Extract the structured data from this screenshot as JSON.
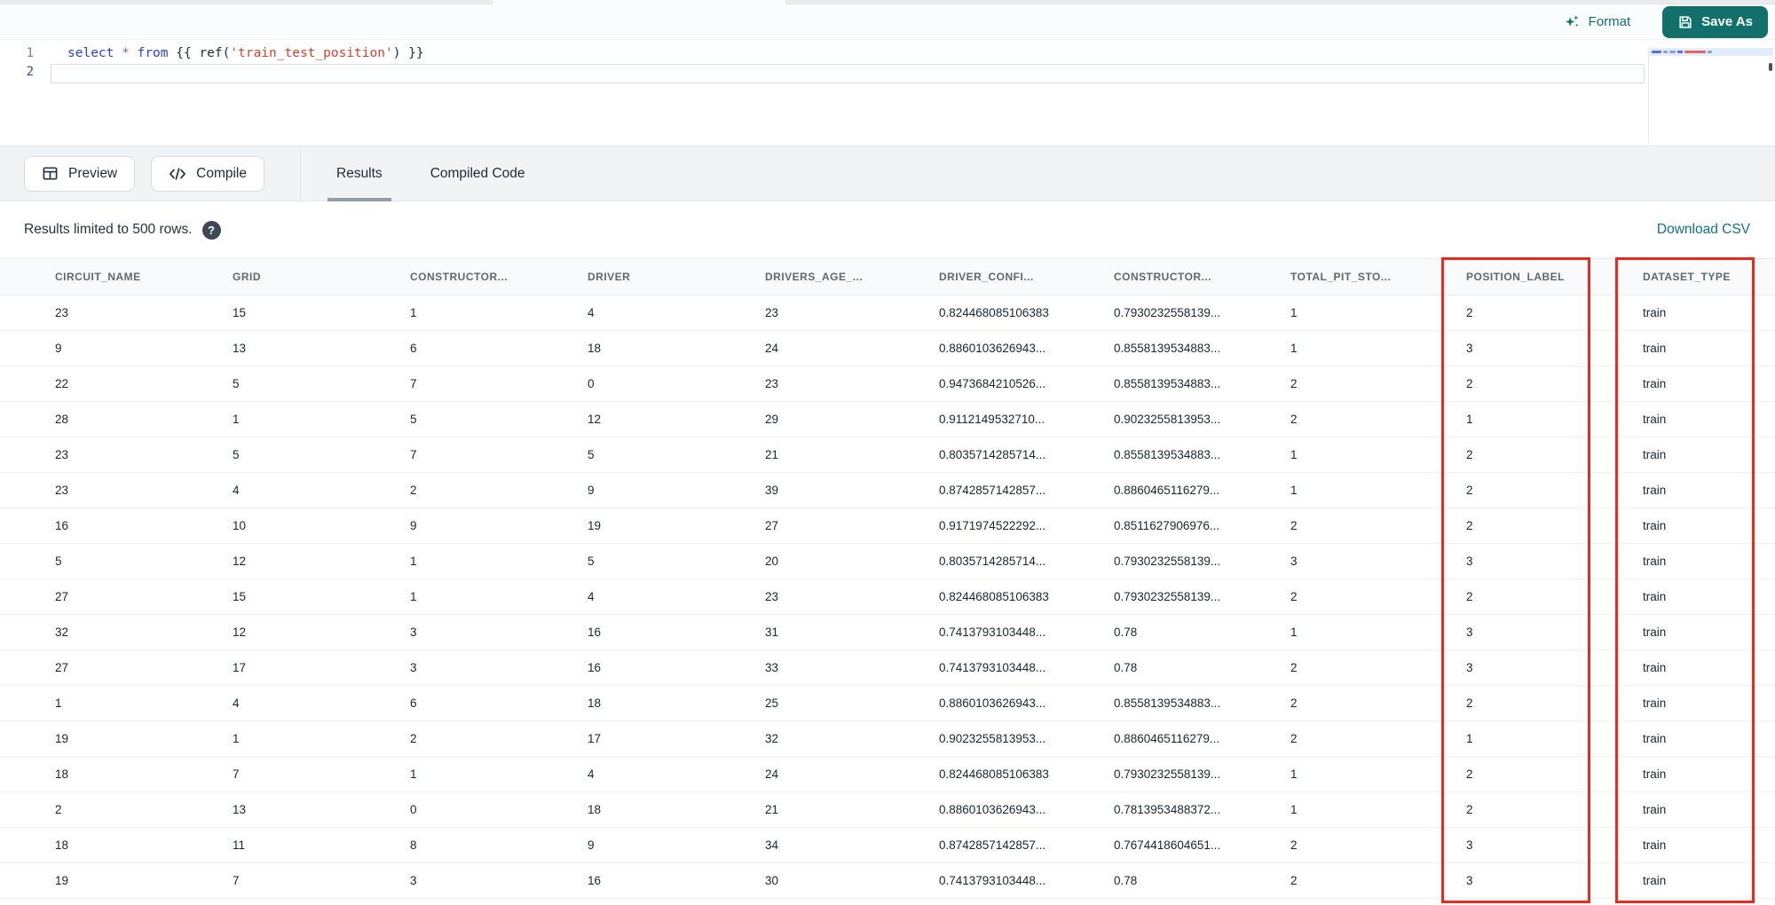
{
  "editor_header": {
    "format_label": "Format",
    "save_as_label": "Save As"
  },
  "code_editor": {
    "line_numbers": [
      "1",
      "2"
    ],
    "lines": [
      {
        "tokens": [
          {
            "text": "select",
            "type": "keyword"
          },
          {
            "text": " ",
            "type": "plain"
          },
          {
            "text": "*",
            "type": "operator"
          },
          {
            "text": " ",
            "type": "plain"
          },
          {
            "text": "from",
            "type": "keyword"
          },
          {
            "text": " {{ ",
            "type": "plain"
          },
          {
            "text": "ref",
            "type": "function"
          },
          {
            "text": "(",
            "type": "plain"
          },
          {
            "text": "'train_test_position'",
            "type": "string"
          },
          {
            "text": ")",
            "type": "plain"
          },
          {
            "text": " }}",
            "type": "plain"
          }
        ]
      },
      {
        "tokens": []
      }
    ]
  },
  "toolbar": {
    "preview_label": "Preview",
    "compile_label": "Compile",
    "tabs": [
      {
        "label": "Results",
        "active": true
      },
      {
        "label": "Compiled Code",
        "active": false
      }
    ]
  },
  "results_bar": {
    "limit_text": "Results limited to 500 rows.",
    "download_label": "Download CSV"
  },
  "table": {
    "columns": [
      "CIRCUIT_NAME",
      "GRID",
      "CONSTRUCTOR...",
      "DRIVER",
      "DRIVERS_AGE_...",
      "DRIVER_CONFI...",
      "CONSTRUCTOR...",
      "TOTAL_PIT_STO...",
      "POSITION_LABEL",
      "DATASET_TYPE"
    ],
    "rows": [
      [
        "23",
        "15",
        "1",
        "4",
        "23",
        "0.824468085106383",
        "0.7930232558139...",
        "1",
        "2",
        "train"
      ],
      [
        "9",
        "13",
        "6",
        "18",
        "24",
        "0.8860103626943...",
        "0.8558139534883...",
        "1",
        "3",
        "train"
      ],
      [
        "22",
        "5",
        "7",
        "0",
        "23",
        "0.9473684210526...",
        "0.8558139534883...",
        "2",
        "2",
        "train"
      ],
      [
        "28",
        "1",
        "5",
        "12",
        "29",
        "0.9112149532710...",
        "0.9023255813953...",
        "2",
        "1",
        "train"
      ],
      [
        "23",
        "5",
        "7",
        "5",
        "21",
        "0.8035714285714...",
        "0.8558139534883...",
        "1",
        "2",
        "train"
      ],
      [
        "23",
        "4",
        "2",
        "9",
        "39",
        "0.8742857142857...",
        "0.8860465116279...",
        "1",
        "2",
        "train"
      ],
      [
        "16",
        "10",
        "9",
        "19",
        "27",
        "0.9171974522292...",
        "0.8511627906976...",
        "2",
        "2",
        "train"
      ],
      [
        "5",
        "12",
        "1",
        "5",
        "20",
        "0.8035714285714...",
        "0.7930232558139...",
        "3",
        "3",
        "train"
      ],
      [
        "27",
        "15",
        "1",
        "4",
        "23",
        "0.824468085106383",
        "0.7930232558139...",
        "2",
        "2",
        "train"
      ],
      [
        "32",
        "12",
        "3",
        "16",
        "31",
        "0.7413793103448...",
        "0.78",
        "1",
        "3",
        "train"
      ],
      [
        "27",
        "17",
        "3",
        "16",
        "33",
        "0.7413793103448...",
        "0.78",
        "2",
        "3",
        "train"
      ],
      [
        "1",
        "4",
        "6",
        "18",
        "25",
        "0.8860103626943...",
        "0.8558139534883...",
        "2",
        "2",
        "train"
      ],
      [
        "19",
        "1",
        "2",
        "17",
        "32",
        "0.9023255813953...",
        "0.8860465116279...",
        "2",
        "1",
        "train"
      ],
      [
        "18",
        "7",
        "1",
        "4",
        "24",
        "0.824468085106383",
        "0.7930232558139...",
        "1",
        "2",
        "train"
      ],
      [
        "2",
        "13",
        "0",
        "18",
        "21",
        "0.8860103626943...",
        "0.7813953488372...",
        "1",
        "2",
        "train"
      ],
      [
        "18",
        "11",
        "8",
        "9",
        "34",
        "0.8742857142857...",
        "0.7674418604651...",
        "2",
        "3",
        "train"
      ],
      [
        "19",
        "7",
        "3",
        "16",
        "30",
        "0.7413793103448...",
        "0.78",
        "2",
        "3",
        "train"
      ]
    ],
    "annotations": {
      "highlight_color": "#ea2a1f",
      "highlighted_columns": [
        "POSITION_LABEL",
        "DATASET_TYPE"
      ]
    }
  },
  "colors": {
    "accent_teal": "#11716a",
    "link_teal": "#10718c",
    "annotation_red": "#ea2a1f"
  }
}
